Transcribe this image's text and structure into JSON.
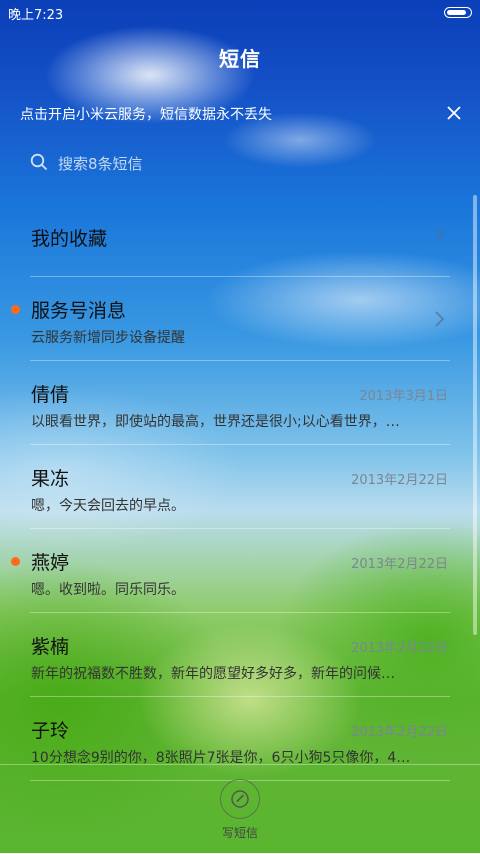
{
  "status_bar": {
    "time": "晚上7:23",
    "battery_icon": "battery-icon"
  },
  "header": {
    "title": "短信"
  },
  "cloud_banner": {
    "text": "点击开启小米云服务，短信数据永不丢失",
    "close_icon": "close-icon"
  },
  "search": {
    "placeholder": "搜索8条短信",
    "value": "",
    "icon": "search-icon"
  },
  "threads": [
    {
      "name": "我的收藏",
      "preview": "",
      "date": "",
      "unread": false,
      "chevron": true
    },
    {
      "name": "服务号消息",
      "preview": "云服务新增同步设备提醒",
      "date": "",
      "unread": true,
      "chevron": true
    },
    {
      "name": "倩倩",
      "preview": "以眼看世界，即使站的最高，世界还是很小;以心看世界，…",
      "date": "2013年3月1日",
      "unread": false,
      "chevron": false
    },
    {
      "name": "果冻",
      "preview": "嗯，今天会回去的早点。",
      "date": "2013年2月22日",
      "unread": false,
      "chevron": false
    },
    {
      "name": "燕婷",
      "preview": "嗯。收到啦。同乐同乐。",
      "date": "2013年2月22日",
      "unread": true,
      "chevron": false
    },
    {
      "name": "紫楠",
      "preview": "新年的祝福数不胜数，新年的愿望好多好多，新年的问候…",
      "date": "2013年2月22日",
      "unread": false,
      "chevron": false
    },
    {
      "name": "子玲",
      "preview": "10分想念9别的你，8张照片7张是你，6只小狗5只像你，4…",
      "date": "2013年2月22日",
      "unread": false,
      "chevron": false
    }
  ],
  "bottom_bar": {
    "compose_label": "写短信",
    "compose_icon": "compose-icon"
  },
  "colors": {
    "unread_dot": "#ff6a1a",
    "header_blue": "#0a3fb8",
    "banner_text": "#ffffff"
  }
}
